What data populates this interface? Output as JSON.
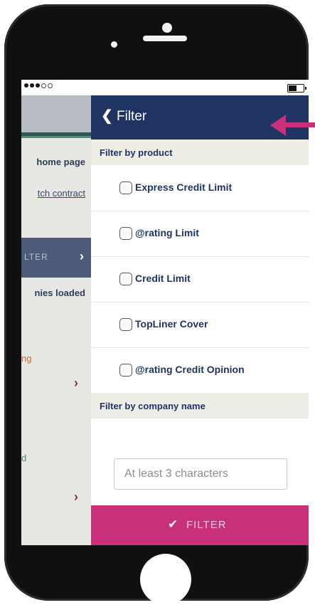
{
  "status_bar": {
    "signal_dots_on": 3,
    "signal_dots_total": 5,
    "battery_level": 0.55
  },
  "background_app": {
    "home_link": "home page",
    "contract_link": "tch contract",
    "filter_button": "LTER",
    "loaded_text": "nies loaded",
    "orange_text": "ng",
    "green_text": "d"
  },
  "panel": {
    "back_icon": "chevron-left-icon",
    "title": "Filter",
    "product_section": "Filter by product",
    "products": [
      {
        "label": "Express Credit Limit",
        "checked": false
      },
      {
        "label": "@rating Limit",
        "checked": false
      },
      {
        "label": "Credit Limit",
        "checked": false
      },
      {
        "label": "TopLiner Cover",
        "checked": false
      },
      {
        "label": "@rating Credit Opinion",
        "checked": false
      }
    ],
    "company_section": "Filter by company name",
    "search_placeholder": "At least 3 characters",
    "filter_button": "FILTER"
  },
  "colors": {
    "header_navy": "#1f3463",
    "accent_magenta": "#c9307b",
    "section_bg": "#eeeee7"
  }
}
